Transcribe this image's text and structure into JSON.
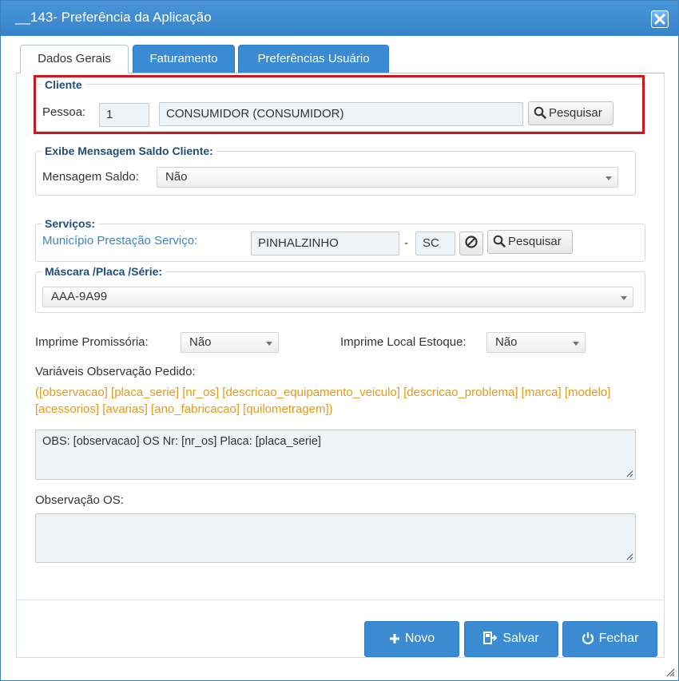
{
  "window": {
    "title": "__143- Preferência da Aplicação",
    "close_icon": "close-icon"
  },
  "tabs": [
    {
      "label": "Dados Gerais",
      "active": true
    },
    {
      "label": "Faturamento",
      "active": false
    },
    {
      "label": "Preferências Usuário",
      "active": false
    }
  ],
  "cliente": {
    "legend": "Cliente",
    "pessoa_label": "Pessoa:",
    "pessoa_code": "1",
    "pessoa_name": "CONSUMIDOR (CONSUMIDOR)",
    "search_label": "Pesquisar"
  },
  "mensagem": {
    "legend": "Exibe Mensagem Saldo Cliente:",
    "label": "Mensagem Saldo:",
    "value": "Não"
  },
  "servicos": {
    "legend": "Serviços:",
    "municipio_label": "Município Prestação Serviço:",
    "municipio_value": "PINHALZINHO",
    "separator": "-",
    "uf_value": "SC",
    "search_label": "Pesquisar"
  },
  "mascara": {
    "legend": "Máscara /Placa /Série:",
    "value": "AAA-9A99"
  },
  "promissoria": {
    "label": "Imprime Promissória:",
    "value": "Não"
  },
  "local_estoque": {
    "label": "Imprime Local Estoque:",
    "value": "Não"
  },
  "variaveis": {
    "label": "Variáveis Observação Pedido:",
    "list": "([observacao] [placa_serie] [nr_os] [descricao_equipamento_veiculo] [descricao_problema] [marca] [modelo] [acessorios] [avarias] [ano_fabricacao] [quilometragem])",
    "text": "OBS: [observacao] OS Nr: [nr_os]  Placa: [placa_serie]"
  },
  "observacao_os": {
    "label": "Observação OS:",
    "text": ""
  },
  "footer": {
    "novo": "Novo",
    "salvar": "Salvar",
    "fechar": "Fechar"
  },
  "colors": {
    "accent": "#3a8bd2",
    "variables": "#e39a1b",
    "highlight": "#d0161a",
    "legend": "#1f4e79"
  }
}
